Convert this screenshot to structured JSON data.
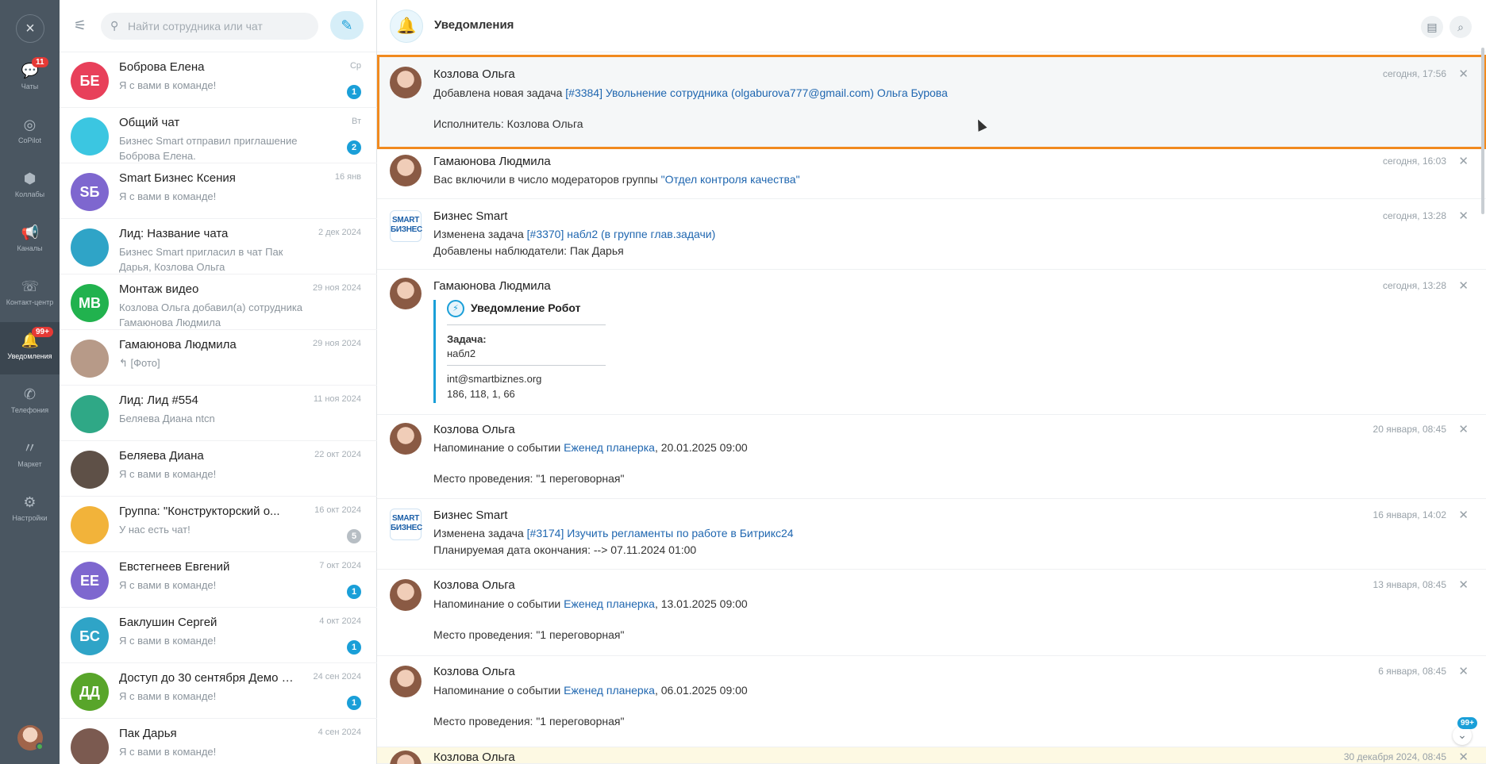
{
  "rail": {
    "items": [
      {
        "label": "Чаты",
        "icon": "chat-bubbles-icon",
        "badge": "11"
      },
      {
        "label": "CoPilot",
        "icon": "copilot-icon",
        "badge": ""
      },
      {
        "label": "Коллабы",
        "icon": "collab-icon",
        "badge": ""
      },
      {
        "label": "Каналы",
        "icon": "megaphone-icon",
        "badge": ""
      },
      {
        "label": "Контакт-центр",
        "icon": "contact-center-icon",
        "badge": ""
      },
      {
        "label": "Уведомления",
        "icon": "bell-icon",
        "badge": "99+"
      },
      {
        "label": "Телефония",
        "icon": "phone-icon",
        "badge": ""
      },
      {
        "label": "Маркет",
        "icon": "market-icon",
        "badge": ""
      },
      {
        "label": "Настройки",
        "icon": "gear-icon",
        "badge": ""
      }
    ]
  },
  "search": {
    "placeholder": "Найти сотрудника или чат"
  },
  "chats": [
    {
      "initials": "БЕ",
      "name": "Боброва Елена",
      "preview": "Я с вами в команде!",
      "time": "Ср",
      "count": "1",
      "color": "#e8405a"
    },
    {
      "initials": "",
      "name": "Общий чат",
      "preview": "Бизнес Smart отправил приглашение Боброва Елена.",
      "time": "Вт",
      "count": "2",
      "color": "#3bc6e1"
    },
    {
      "initials": "SБ",
      "name": "Smart Бизнес Ксения",
      "preview": "Я с вами в команде!",
      "time": "16 янв",
      "count": "",
      "color": "#7e67cf"
    },
    {
      "initials": "",
      "name": "Лид: Название чата",
      "preview": "Бизнес Smart пригласил в чат Пак Дарья, Козлова Ольга",
      "time": "2 дек 2024",
      "count": "",
      "color": "#2fa4c7"
    },
    {
      "initials": "МВ",
      "name": "Монтаж видео",
      "preview": "Козлова Ольга добавил(а) сотрудника Гамаюнова Людмила",
      "time": "29 ноя 2024",
      "count": "",
      "color": "#21b24e"
    },
    {
      "initials": "",
      "name": "Гамаюнова Людмила",
      "preview": "↰ [Фото]",
      "time": "29 ноя 2024",
      "count": "",
      "color": "#b79a88"
    },
    {
      "initials": "",
      "name": "Лид: Лид #554",
      "preview": "Беляева Диана ntcn",
      "time": "11 ноя 2024",
      "count": "",
      "color": "#2fa886"
    },
    {
      "initials": "",
      "name": "Беляева Диана",
      "preview": "Я с вами в команде!",
      "time": "22 окт 2024",
      "count": "",
      "color": "#5e5047"
    },
    {
      "initials": "",
      "name": "Группа: \"Конструкторский о...",
      "preview": "У нас есть чат!",
      "time": "16 окт 2024",
      "count": "5",
      "color": "#f2b33a"
    },
    {
      "initials": "ЕЕ",
      "name": "Евстегнеев Евгений",
      "preview": "Я с вами в команде!",
      "time": "7 окт 2024",
      "count": "1",
      "color": "#7e67cf"
    },
    {
      "initials": "БС",
      "name": "Баклушин Сергей",
      "preview": "Я с вами в команде!",
      "time": "4 окт 2024",
      "count": "1",
      "color": "#2fa4c7"
    },
    {
      "initials": "ДД",
      "name": "Доступ до 30 сентября Демо д...",
      "preview": "Я с вами в команде!",
      "time": "24 сен 2024",
      "count": "1",
      "color": "#58a52a"
    },
    {
      "initials": "",
      "name": "Пак Дарья",
      "preview": "Я с вами в команде!",
      "time": "4 сен 2024",
      "count": "",
      "color": "#7b5a50"
    }
  ],
  "header": {
    "title": "Уведомления"
  },
  "notifications": {
    "n1": {
      "name": "Козлова Ольга",
      "time": "сегодня, 17:56",
      "text": "Добавлена новая задача ",
      "link": "[#3384] Увольнение сотрудника (olgaburova777@gmail.com) Ольга Бурова",
      "extra": "Исполнитель: Козлова Ольга"
    },
    "n2": {
      "name": "Гамаюнова Людмила",
      "time": "сегодня, 16:03",
      "text": "Вас включили в число модераторов группы ",
      "link": "\"Отдел контроля качества\""
    },
    "n3": {
      "name": "Бизнес Smart",
      "time": "сегодня, 13:28",
      "text": "Изменена задача ",
      "link": "[#3370] набл2 (в группе глав.задачи)",
      "extra": "Добавлены наблюдатели: Пак Дарья"
    },
    "n4": {
      "name": "Гамаюнова Людмила",
      "time": "сегодня, 13:28",
      "robot_title": "Уведомление Робот",
      "task_label": "Задача:",
      "task_link": "набл2",
      "email": "int@smartbiznes.org",
      "numbers": "186, 118, 1, 66"
    },
    "n5": {
      "name": "Козлова Ольга",
      "time": "20 января, 08:45",
      "text": "Напоминание о событии ",
      "link": "Еженед планерка",
      "date": ", 20.01.2025 09:00",
      "place_label": "Место проведения: ",
      "place": "\"1 переговорная\""
    },
    "n6": {
      "name": "Бизнес Smart",
      "time": "16 января, 14:02",
      "text": "Изменена задача ",
      "link": "[#3174] Изучить регламенты по работе в Битрикс24",
      "extra": "Планируемая дата окончания: --> 07.11.2024 01:00"
    },
    "n7": {
      "name": "Козлова Ольга",
      "time": "13 января, 08:45",
      "text": "Напоминание о событии ",
      "link": "Еженед планерка",
      "date": ", 13.01.2025 09:00",
      "place_label": "Место проведения: ",
      "place": "\"1 переговорная\""
    },
    "n8": {
      "name": "Козлова Ольга",
      "time": "6 января, 08:45",
      "text": "Напоминание о событии ",
      "link": "Еженед планерка",
      "date": ", 06.01.2025 09:00",
      "place_label": "Место проведения: ",
      "place": "\"1 переговорная\""
    },
    "n9": {
      "name": "Козлова Ольга",
      "time": "30 декабря 2024, 08:45"
    }
  },
  "scroll_badge": "99+",
  "smart_logo": "SMART БИЗНЕС"
}
